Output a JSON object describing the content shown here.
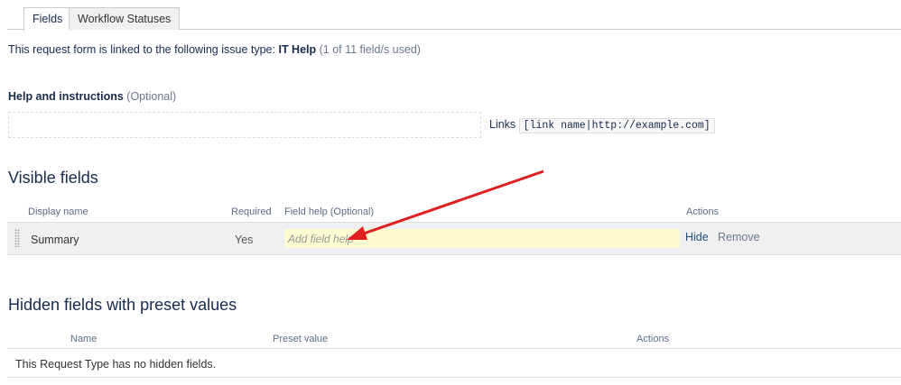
{
  "tabs": [
    "Fields",
    "Workflow Statuses"
  ],
  "linked": {
    "prefix": "This request form is linked to the following issue type:",
    "issue_type": "IT Help",
    "usage": "(1 of 11 field/s used)"
  },
  "help": {
    "label": "Help and instructions",
    "optional": "(Optional)",
    "links_label": "Links",
    "links_syntax": "[link name|http://example.com]"
  },
  "visible": {
    "title": "Visible fields",
    "headers": {
      "display": "Display name",
      "required": "Required",
      "help": "Field help",
      "help_opt": "(Optional)",
      "actions": "Actions"
    },
    "rows": [
      {
        "name": "Summary",
        "required": "Yes",
        "placeholder": "Add field help",
        "hide": "Hide",
        "remove": "Remove"
      }
    ]
  },
  "hidden": {
    "title": "Hidden fields with preset values",
    "headers": {
      "name": "Name",
      "preset": "Preset value",
      "actions": "Actions"
    },
    "empty": "This Request Type has no hidden fields."
  },
  "colors": {
    "link": "#205081",
    "arrow": "#e02020"
  }
}
